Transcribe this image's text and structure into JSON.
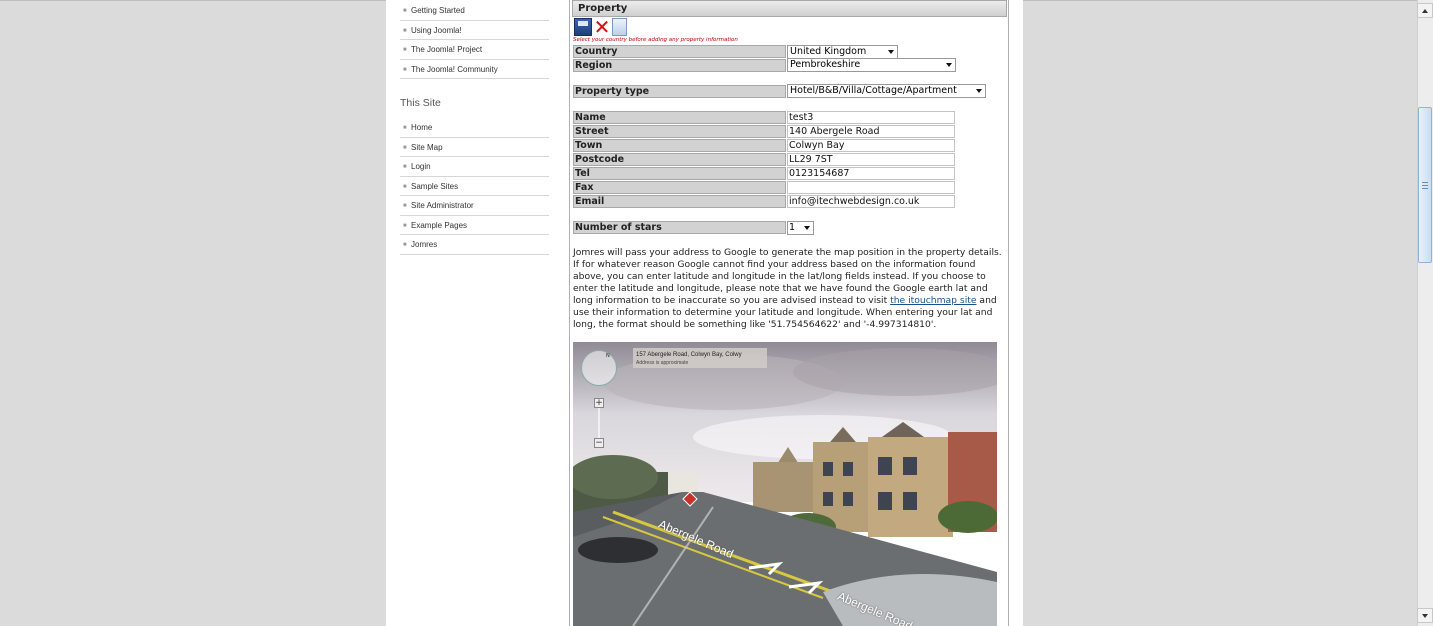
{
  "menu_top": [
    {
      "label": "Getting Started"
    },
    {
      "label": "Using Joomla!"
    },
    {
      "label": "The Joomla! Project"
    },
    {
      "label": "The Joomla! Community"
    }
  ],
  "this_site": {
    "title": "This Site",
    "items": [
      {
        "label": "Home"
      },
      {
        "label": "Site Map"
      },
      {
        "label": "Login"
      },
      {
        "label": "Sample Sites"
      },
      {
        "label": "Site Administrator"
      },
      {
        "label": "Example Pages"
      },
      {
        "label": "Jomres"
      }
    ]
  },
  "property": {
    "header": "Property",
    "notice": "Select your country before adding any property information",
    "country": {
      "label": "Country",
      "value": "United Kingdom"
    },
    "region": {
      "label": "Region",
      "value": "Pembrokeshire"
    },
    "property_type": {
      "label": "Property type",
      "value": "Hotel/B&B/Villa/Cottage/Apartment"
    },
    "fields": [
      {
        "label": "Name",
        "value": "test3"
      },
      {
        "label": "Street",
        "value": "140 Abergele Road"
      },
      {
        "label": "Town",
        "value": "Colwyn Bay"
      },
      {
        "label": "Postcode",
        "value": "LL29 7ST"
      },
      {
        "label": "Tel",
        "value": "0123154687"
      },
      {
        "label": "Fax",
        "value": ""
      },
      {
        "label": "Email",
        "value": "info@itechwebdesign.co.uk"
      }
    ],
    "stars": {
      "label": "Number of stars",
      "value": "1"
    }
  },
  "intro": {
    "text_before": "Jomres will pass your address to Google to generate the map position in the property details. If for whatever reason Google cannot find your address based on the information found above, you can enter latitude and longitude in the lat/long fields instead. If you choose to enter the latitude and longitude, please note that we have found the Google earth lat and long information to be inaccurate so you are advised instead to visit ",
    "link": "the itouchmap site",
    "text_after": " and use their information to determine your latitude and longitude. When entering your lat and long, the format should be something like '51.754564622' and '-4.997314810'."
  },
  "map": {
    "address": "157 Abergele Road, Colwyn Bay, Colwy",
    "approx": "Address is approximate",
    "north": "N",
    "zoom_in": "+",
    "zoom_out": "−",
    "road_label": "Abergele Road",
    "road_label_2": "Abergele Road"
  },
  "colors": {
    "page_bg": "#dcdbdb",
    "content_bg": "#ffffff",
    "label_bg": "#d2d2d2",
    "link": "#1a4f8f",
    "notice": "#c00000"
  }
}
